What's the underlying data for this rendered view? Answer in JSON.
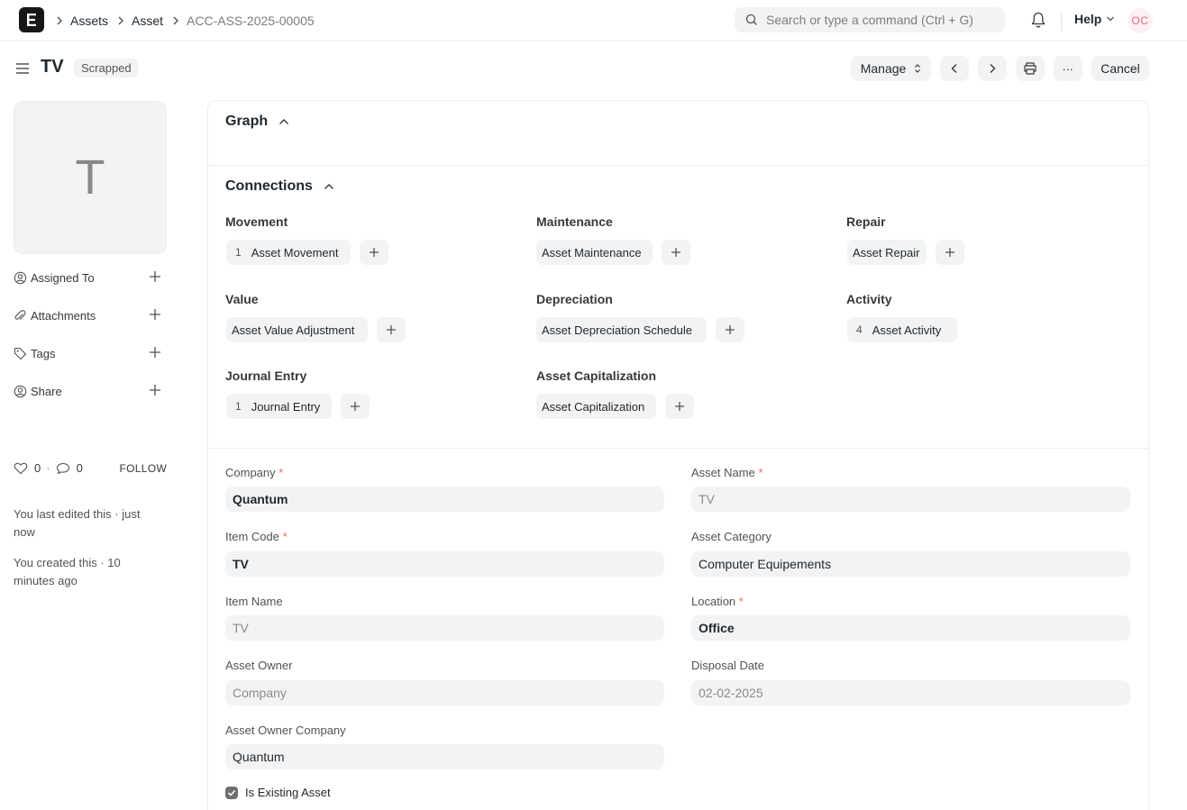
{
  "navbar": {
    "logo_letter": "E",
    "breadcrumbs": [
      "Assets",
      "Asset",
      "ACC-ASS-2025-00005"
    ],
    "search_placeholder": "Search or type a command (Ctrl + G)",
    "help_label": "Help",
    "user_initials": "OC"
  },
  "page": {
    "title": "TV",
    "status": "Scrapped",
    "actions": {
      "manage": "Manage",
      "more": "...",
      "cancel": "Cancel"
    }
  },
  "sidebar": {
    "avatar_letter": "T",
    "rows": [
      {
        "label": "Assigned To",
        "icon": "assign-icon"
      },
      {
        "label": "Attachments",
        "icon": "paperclip-icon"
      },
      {
        "label": "Tags",
        "icon": "tag-icon"
      },
      {
        "label": "Share",
        "icon": "share-icon"
      }
    ],
    "likes": "0",
    "comments": "0",
    "dot": "·",
    "follow": "FOLLOW",
    "last_edited": "You last edited this · just now",
    "created": "You created this · 10 minutes ago"
  },
  "sections": {
    "graph": "Graph",
    "connections": "Connections"
  },
  "connections": [
    {
      "group": "Movement",
      "doc": "Asset Movement",
      "count": "1"
    },
    {
      "group": "Maintenance",
      "doc": "Asset Maintenance",
      "count": ""
    },
    {
      "group": "Repair",
      "doc": "Asset Repair",
      "count": ""
    },
    {
      "group": "Value",
      "doc": "Asset Value Adjustment",
      "count": ""
    },
    {
      "group": "Depreciation",
      "doc": "Asset Depreciation Schedule",
      "count": ""
    },
    {
      "group": "Activity",
      "doc": "Asset Activity",
      "count": "4"
    },
    {
      "group": "Journal Entry",
      "doc": "Journal Entry",
      "count": "1"
    },
    {
      "group": "Asset Capitalization",
      "doc": "Asset Capitalization",
      "count": ""
    }
  ],
  "form": {
    "company": {
      "label": "Company",
      "value": "Quantum",
      "required": "*"
    },
    "asset_name": {
      "label": "Asset Name",
      "value": "TV",
      "required": "*"
    },
    "item_code": {
      "label": "Item Code",
      "value": "TV",
      "required": "*"
    },
    "asset_category": {
      "label": "Asset Category",
      "value": "Computer Equipements"
    },
    "item_name": {
      "label": "Item Name",
      "value": "TV"
    },
    "location": {
      "label": "Location",
      "value": "Office",
      "required": "*"
    },
    "asset_owner": {
      "label": "Asset Owner",
      "value": "Company"
    },
    "disposal_date": {
      "label": "Disposal Date",
      "value": "02-02-2025"
    },
    "asset_owner_company": {
      "label": "Asset Owner Company",
      "value": "Quantum"
    },
    "is_existing_asset": {
      "label": "Is Existing Asset",
      "checked": true
    }
  }
}
